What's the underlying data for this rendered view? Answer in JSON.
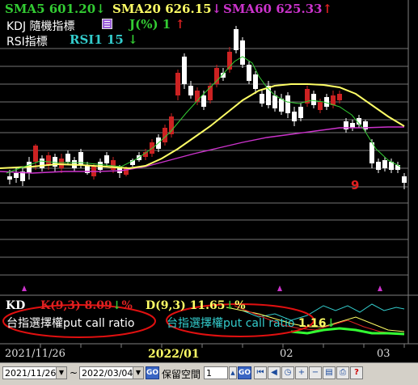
{
  "legend": {
    "sma5": "SMA5",
    "sma5_val": "601.20",
    "sma5_arrow": "↓",
    "sma20": "SMA20",
    "sma20_val": "626.15",
    "sma20_arrow": "↓",
    "sma60": "SMA60",
    "sma60_val": "625.33",
    "sma60_arrow": "↑",
    "kdj": "KDJ 隨機指標",
    "j_label": "J(%)",
    "j_val": "1",
    "j_arrow": "↑",
    "rsi": "RSI指標",
    "rsi1": "RSI1",
    "rsi1_val": "15",
    "rsi1_arrow": "↓"
  },
  "annotation": {
    "nine": "9"
  },
  "kd_panel": {
    "title": "KD",
    "k_label": "K(9,3)",
    "k_val": "8.09",
    "k_arrow": "↓",
    "k_pct": "%",
    "d_label": "D(9,3)",
    "d_val": "11.65",
    "d_arrow": "↓",
    "d_pct": "%",
    "note_left": "台指選擇權put call ratio",
    "note_right": "台指選擇權put call ratio",
    "note_right_val": "1.16",
    "note_right_arrow": "↓"
  },
  "date_axis": [
    "2021/11/26",
    "2022/01",
    "02",
    "03"
  ],
  "toolbar": {
    "start_date": "2021/11/26",
    "tilde": "~",
    "end_date": "2022/03/04",
    "go": "GO",
    "reserve_label": "保留空間",
    "reserve_value": "1",
    "go2": "GO",
    "icons": [
      "step-first-icon",
      "step-back-icon",
      "clock-icon",
      "zoom-in-icon",
      "zoom-out-icon",
      "chart-icon",
      "print-icon",
      "help-icon"
    ]
  },
  "colors": {
    "sma5": "#33cc33",
    "sma20": "#ffff66",
    "sma60": "#cc33cc",
    "up_candle": "#cc2222",
    "down_candle": "#ffffff",
    "rsi1": "#33cccc"
  }
}
